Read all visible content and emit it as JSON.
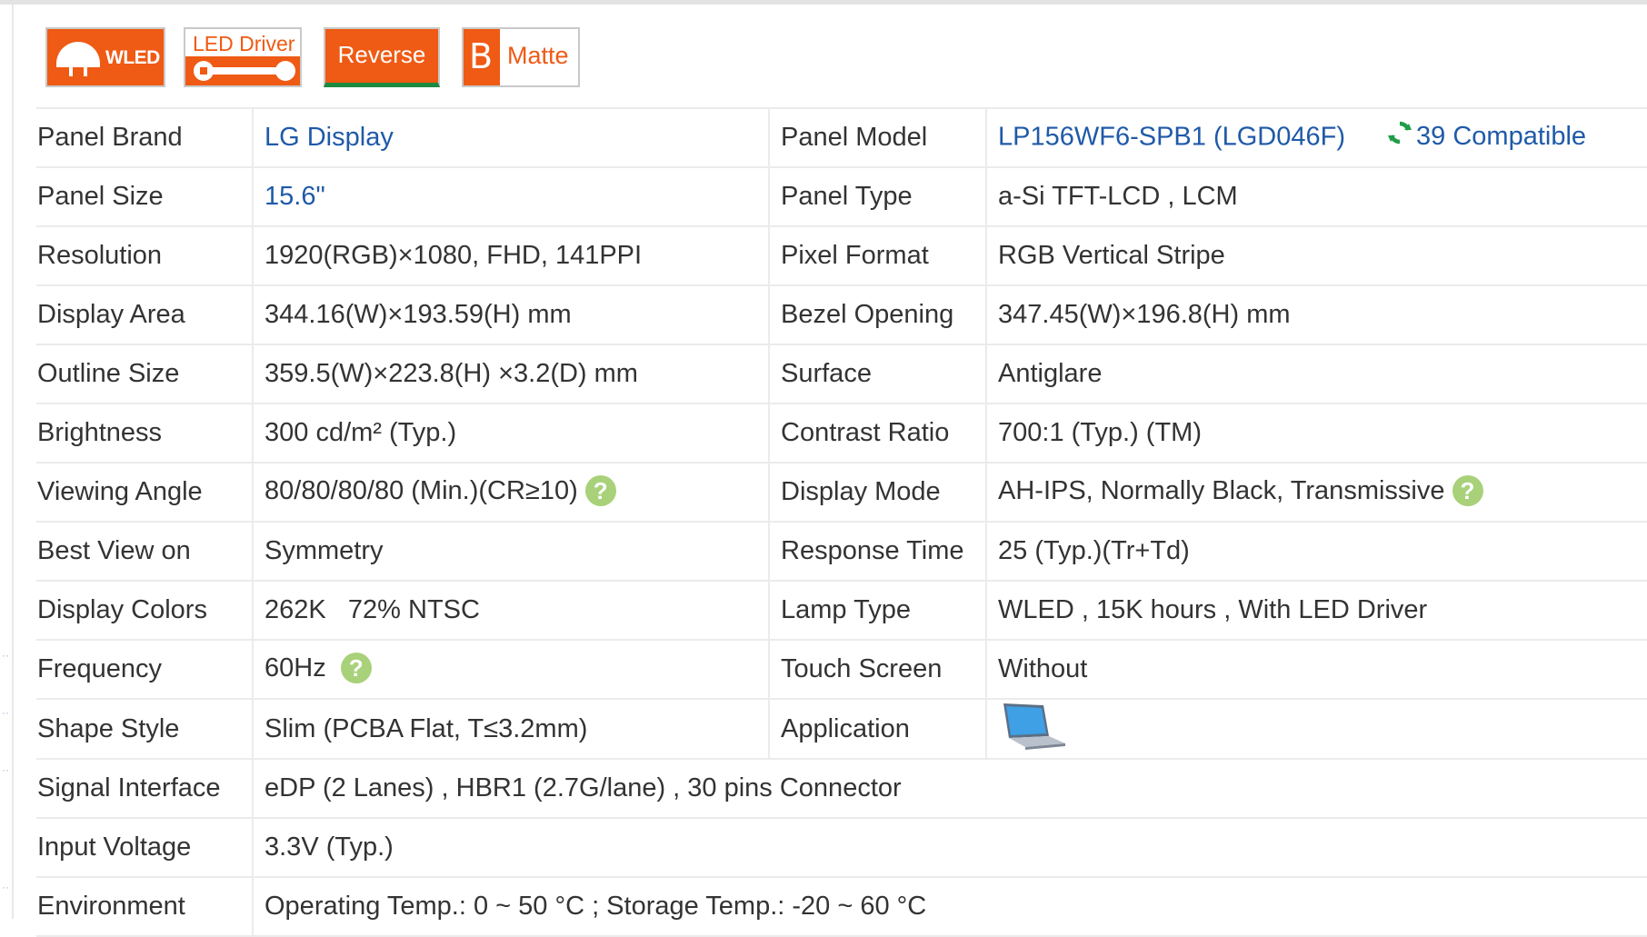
{
  "badges": {
    "wled": "WLED",
    "led_driver": "LED Driver",
    "reverse": "Reverse",
    "matte_letter": "B",
    "matte": "Matte"
  },
  "colors": {
    "badge_orange": "#ef5a14",
    "badge_green": "#1d8a3f",
    "link_blue": "#1f5aa8",
    "help_green": "#a8d17a",
    "text": "#333333",
    "grid": "#ebebeb"
  },
  "icons": {
    "help": "question-mark-circle-icon",
    "compatible": "refresh-sync-icon",
    "application": "laptop-icon"
  },
  "help_glyph": "?",
  "rows": [
    {
      "label": "Panel Brand",
      "value": "LG Display",
      "label2": "Panel Model",
      "value2": "LP156WF6-SPB1 (LGD046F)",
      "compatible": "39 Compatible"
    },
    {
      "label": "Panel Size",
      "value": "15.6\"",
      "label2": "Panel Type",
      "value2": "a-Si TFT-LCD , LCM"
    },
    {
      "label": "Resolution",
      "value": "1920(RGB)×1080, FHD, 141PPI",
      "label2": "Pixel Format",
      "value2": "RGB Vertical Stripe"
    },
    {
      "label": "Display Area",
      "value": "344.16(W)×193.59(H) mm",
      "label2": "Bezel Opening",
      "value2": "347.45(W)×196.8(H) mm"
    },
    {
      "label": "Outline Size",
      "value": "359.5(W)×223.8(H) ×3.2(D) mm",
      "label2": "Surface",
      "value2": "Antiglare"
    },
    {
      "label": "Brightness",
      "value": "300 cd/m² (Typ.)",
      "label2": "Contrast Ratio",
      "value2": "700:1 (Typ.) (TM)"
    },
    {
      "label": "Viewing Angle",
      "value": "80/80/80/80 (Min.)(CR≥10)",
      "label2": "Display Mode",
      "value2": "AH-IPS, Normally Black, Transmissive"
    },
    {
      "label": "Best View on",
      "value": "Symmetry",
      "label2": "Response Time",
      "value2": "25 (Typ.)(Tr+Td)"
    },
    {
      "label": "Display Colors",
      "value": "262K   72% NTSC",
      "label2": "Lamp Type",
      "value2": "WLED , 15K hours , With LED Driver"
    },
    {
      "label": "Frequency",
      "value": "60Hz",
      "label2": "Touch Screen",
      "value2": "Without"
    },
    {
      "label": "Shape Style",
      "value": "Slim (PCBA Flat, T≤3.2mm)",
      "label2": "Application",
      "value2": ""
    },
    {
      "label": "Signal Interface",
      "value": "eDP (2 Lanes) , HBR1 (2.7G/lane) , 30 pins Connector"
    },
    {
      "label": "Input Voltage",
      "value": "3.3V (Typ.)"
    },
    {
      "label": "Environment",
      "value": "Operating Temp.: 0 ~ 50 °C ; Storage Temp.: -20 ~ 60 °C"
    }
  ]
}
